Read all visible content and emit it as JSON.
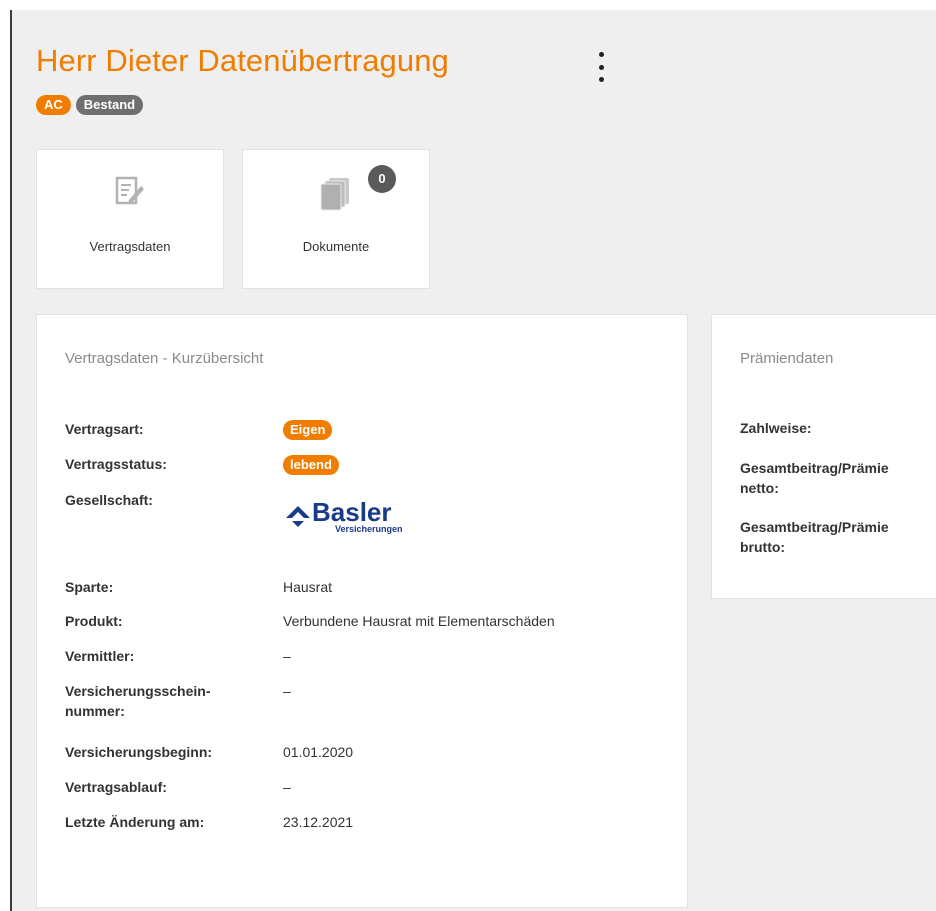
{
  "header": {
    "title": "Herr Dieter Datenübertragung",
    "badges": [
      "AC",
      "Bestand"
    ]
  },
  "tiles": [
    {
      "label": "Vertragsdaten",
      "icon": "contract-edit-icon"
    },
    {
      "label": "Dokumente",
      "icon": "documents-icon",
      "count": "0"
    }
  ],
  "overview": {
    "title": "Vertragsdaten - Kurzübersicht",
    "vertragsart": {
      "label": "Vertragsart:",
      "value": "Eigen"
    },
    "vertragsstatus": {
      "label": "Vertragsstatus:",
      "value": "lebend"
    },
    "gesellschaft": {
      "label": "Gesellschaft:",
      "logo_name": "Basler",
      "logo_sub": "Versicherungen"
    },
    "sparte": {
      "label": "Sparte:",
      "value": "Hausrat"
    },
    "produkt": {
      "label": "Produkt:",
      "value": "Verbundene Hausrat mit Elementarschäden"
    },
    "vermittler": {
      "label": "Vermittler:",
      "value": "–"
    },
    "versicherungsscheinnummer": {
      "label_line1": "Versicherungsschein-",
      "label_line2": "nummer:",
      "value": "–"
    },
    "versicherungsbeginn": {
      "label": "Versicherungsbeginn:",
      "value": "01.01.2020"
    },
    "vertragsablauf": {
      "label": "Vertragsablauf:",
      "value": "–"
    },
    "letzte_aenderung": {
      "label": "Letzte Änderung am:",
      "value": "23.12.2021"
    }
  },
  "premium": {
    "title": "Prämiendaten",
    "zahlweise": {
      "label": "Zahlweise:"
    },
    "netto": {
      "label_line1": "Gesamtbeitrag/Prämie",
      "label_line2": "netto:"
    },
    "brutto": {
      "label_line1": "Gesamtbeitrag/Prämie",
      "label_line2": "brutto:"
    }
  },
  "colors": {
    "accent": "#f07c00",
    "badge_gray": "#6f6f6f",
    "logo_blue": "#1a3a8a"
  }
}
